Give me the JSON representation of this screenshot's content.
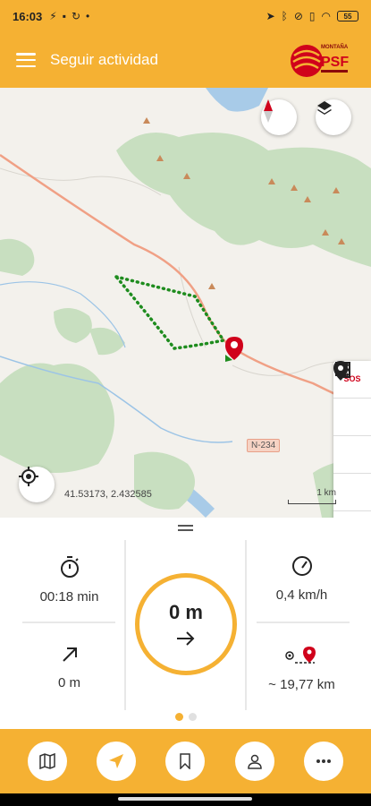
{
  "statusbar": {
    "time": "16:03",
    "battery": "55"
  },
  "appbar": {
    "title": "Seguir actividad",
    "logo_text_top": "MONTAÑA",
    "logo_text_main": "PSF"
  },
  "map": {
    "coords": "41.53173, 2.432585",
    "scale_label": "1 km",
    "road_label": "N-234",
    "sos_label": "SOS",
    "colors": {
      "track": "#1e8c1e",
      "route": "#f0a085",
      "forest": "#c8dfc0",
      "water": "#a8cbe8",
      "marker": "#d0021b"
    }
  },
  "stats": {
    "time_value": "00:18 min",
    "speed_value": "0,4 km/h",
    "distance_center": "0 m",
    "elevation_value": "0 m",
    "remaining_value": "~ 19,77 km"
  },
  "icons": {
    "menu": "hamburger-icon",
    "compass": "compass-icon",
    "layers": "layers-icon",
    "sos": "phone-icon",
    "exit": "exit-icon",
    "pause": "pause-icon",
    "settings": "gear-icon",
    "pin": "location-pin-icon",
    "locate": "crosshair-icon",
    "timer": "stopwatch-icon",
    "speed": "speedometer-icon",
    "elevation": "arrow-up-right-icon",
    "remaining": "marker-distance-icon",
    "direction": "arrow-right-icon"
  },
  "pager": {
    "pages": 2,
    "active": 0
  },
  "accent": "#f5b133"
}
